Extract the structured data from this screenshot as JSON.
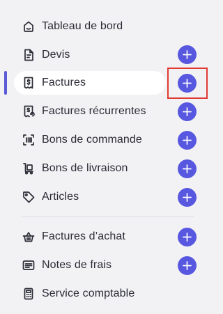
{
  "nav": {
    "items": [
      {
        "label": "Tableau de bord",
        "icon": "dashboard-icon"
      },
      {
        "label": "Devis",
        "icon": "document-icon"
      },
      {
        "label": "Factures",
        "icon": "invoice-icon"
      },
      {
        "label": "Factures récurrentes",
        "icon": "recurring-invoice-icon"
      },
      {
        "label": "Bons de commande",
        "icon": "barcode-icon"
      },
      {
        "label": "Bons de livraison",
        "icon": "delivery-cart-icon"
      },
      {
        "label": "Articles",
        "icon": "tag-icon"
      },
      {
        "label": "Factures d’achat",
        "icon": "basket-icon"
      },
      {
        "label": "Notes de frais",
        "icon": "receipt-lines-icon"
      },
      {
        "label": "Service comptable",
        "icon": "calculator-icon"
      }
    ],
    "active_item": "Factures"
  },
  "colors": {
    "accent": "#5757e0",
    "active_bar": "#5b5bd6",
    "highlight": "#e03a32",
    "background": "#f2f2f4"
  }
}
